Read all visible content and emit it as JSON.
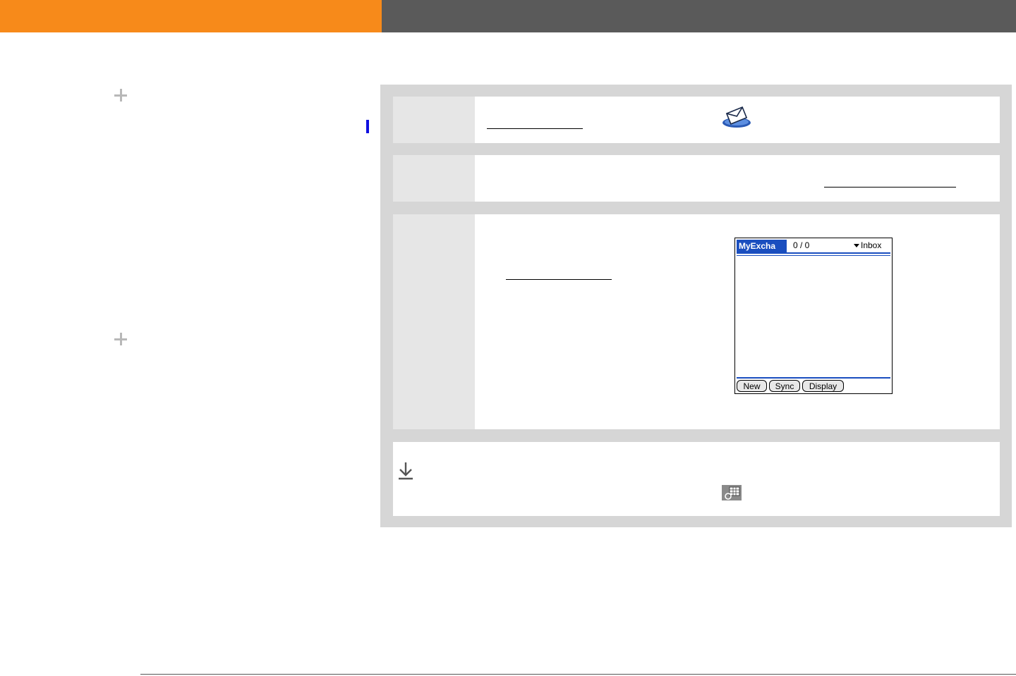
{
  "colors": {
    "header_orange": "#f78a1a",
    "header_gray": "#5a5a5a",
    "panel_gray": "#d6d6d6",
    "step_number_bg": "#e6e6e6",
    "side_marker_blue": "#1010e0",
    "device_blue": "#1a4ebf"
  },
  "icons": {
    "sidebar_plus_1": "plus-icon",
    "sidebar_plus_2": "plus-icon",
    "step1_app": "mail-envelope-icon",
    "tip": "down-arrow-icon",
    "tip_app": "sync-calendar-icon"
  },
  "device_screen": {
    "account_tab": "MyExcha",
    "message_count": "0 / 0",
    "folder": "Inbox",
    "buttons": [
      "New",
      "Sync",
      "Display"
    ]
  }
}
